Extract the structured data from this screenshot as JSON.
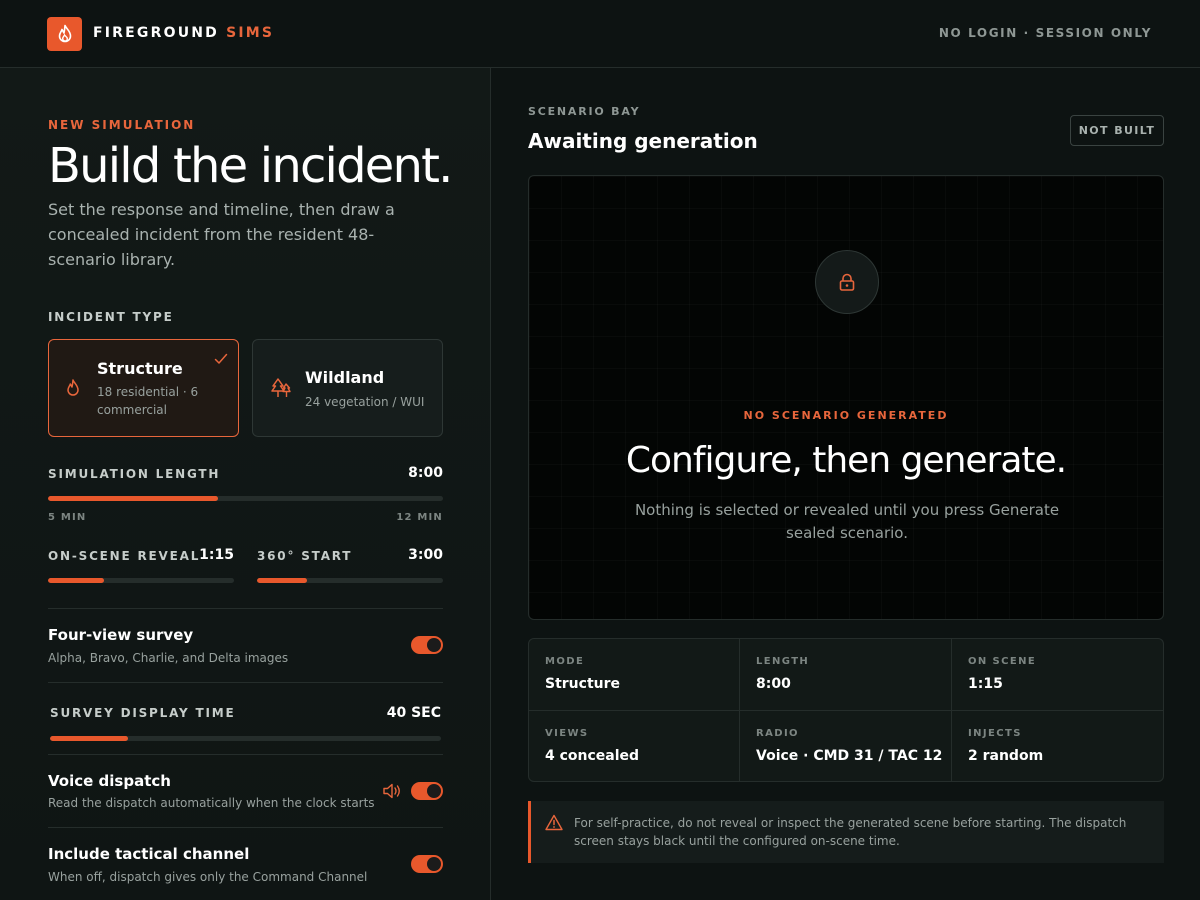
{
  "header": {
    "brand_main": "FIREGROUND",
    "brand_accent": "SIMS",
    "session": "NO LOGIN · SESSION ONLY"
  },
  "left": {
    "eyebrow": "NEW SIMULATION",
    "title": "Build the incident.",
    "lead": "Set the response and timeline, then draw a concealed incident from the resident 48-scenario library.",
    "incident_type": {
      "label": "INCIDENT TYPE",
      "options": [
        {
          "title": "Structure",
          "sub": "18 residential · 6 commercial",
          "selected": true,
          "icon": "flame-icon"
        },
        {
          "title": "Wildland",
          "sub": "24 vegetation / WUI",
          "selected": false,
          "icon": "trees-icon"
        }
      ]
    },
    "sim_length": {
      "label": "SIMULATION LENGTH",
      "value": "8:00",
      "min": "5 MIN",
      "max": "12 MIN",
      "fill": 0.43
    },
    "on_scene": {
      "label": "ON-SCENE REVEAL",
      "value": "1:15",
      "fill": 0.3
    },
    "start_360": {
      "label": "360° START",
      "value": "3:00",
      "fill": 0.27
    },
    "four_view": {
      "title": "Four-view survey",
      "sub": "Alpha, Bravo, Charlie, and Delta images",
      "on": true
    },
    "survey_time": {
      "label": "SURVEY DISPLAY TIME",
      "value": "40 SEC",
      "fill": 0.2
    },
    "voice": {
      "title": "Voice dispatch",
      "sub": "Read the dispatch automatically when the clock starts",
      "on": true,
      "icon": "speaker-icon"
    },
    "tactical": {
      "title": "Include tactical channel",
      "sub": "When off, dispatch gives only the Command Channel",
      "on": true
    }
  },
  "right": {
    "bay_label": "SCENARIO BAY",
    "bay_title": "Awaiting generation",
    "badge": "NOT BUILT",
    "stage": {
      "icon": "lock-icon",
      "eyebrow": "NO SCENARIO GENERATED",
      "heading": "Configure, then generate.",
      "text": "Nothing is selected or revealed until you press Generate sealed scenario."
    },
    "summary": [
      {
        "key": "MODE",
        "value": "Structure"
      },
      {
        "key": "LENGTH",
        "value": "8:00"
      },
      {
        "key": "ON SCENE",
        "value": "1:15"
      },
      {
        "key": "VIEWS",
        "value": "4 concealed"
      },
      {
        "key": "RADIO",
        "value": "Voice · CMD 31 / TAC 12"
      },
      {
        "key": "INJECTS",
        "value": "2 random"
      }
    ],
    "notice": {
      "icon": "warning-icon",
      "text": "For self-practice, do not reveal or inspect the generated scene before starting. The dispatch screen stays black until the configured on-scene time."
    }
  },
  "colors": {
    "accent": "#e8582c",
    "background": "#0d1312",
    "panel": "#121917"
  }
}
